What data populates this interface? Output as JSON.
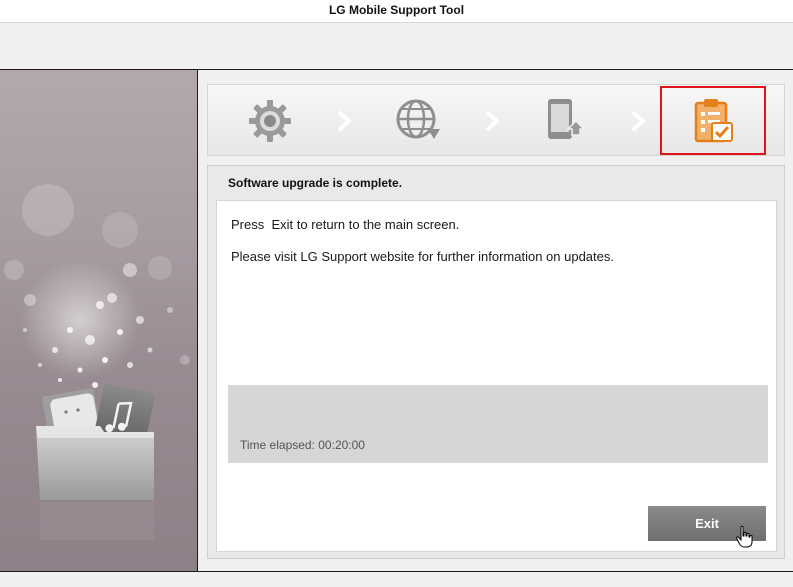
{
  "window": {
    "title": "LG Mobile Support Tool"
  },
  "steps": [
    {
      "icon": "gear-icon",
      "state": "done"
    },
    {
      "icon": "globe-download-icon",
      "state": "done"
    },
    {
      "icon": "phone-upload-icon",
      "state": "done"
    },
    {
      "icon": "clipboard-check-icon",
      "state": "active"
    }
  ],
  "colors": {
    "active_step": "#f08a24",
    "highlight_border": "#e0141c",
    "inactive_step": "#8c8c8c"
  },
  "content": {
    "status_title": "Software upgrade is complete.",
    "message_1": "Press  Exit to return to the main screen.",
    "message_2": "Please visit LG Support website for further information on updates.",
    "elapsed": "Time elapsed: 00:20:00"
  },
  "buttons": {
    "exit": "Exit"
  }
}
